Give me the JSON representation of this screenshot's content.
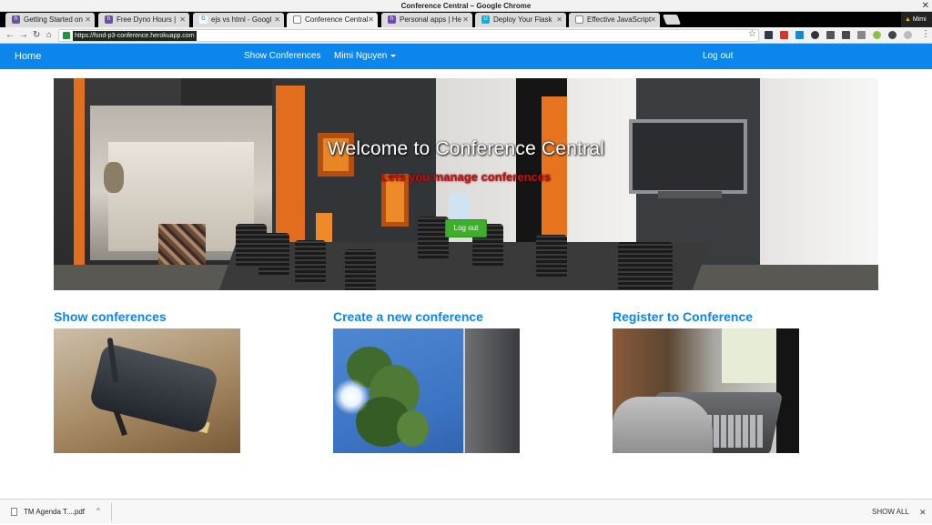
{
  "window": {
    "title": "Conference Central – Google Chrome"
  },
  "tabs": [
    {
      "label": "Getting Started on",
      "favicon": "heroku",
      "favicon_color": "#6d4eac"
    },
    {
      "label": "Free Dyno Hours |",
      "favicon": "heroku",
      "favicon_color": "#6d4eac"
    },
    {
      "label": "ejs vs html - Googl",
      "favicon": "google",
      "favicon_color": "#ffffff"
    },
    {
      "label": "Conference Central",
      "favicon": "page",
      "favicon_color": "#ffffff"
    },
    {
      "label": "Personal apps | He",
      "favicon": "heroku",
      "favicon_color": "#6d4eac"
    },
    {
      "label": "Deploy Your Flask",
      "favicon": "udacity",
      "favicon_color": "#02b3e4"
    },
    {
      "label": "Effective JavaScript",
      "favicon": "page",
      "favicon_color": "#ffffff"
    }
  ],
  "profile": {
    "warning": "▲",
    "name": "Mimi"
  },
  "addressbar": {
    "url": "https://fsnd-p3-conference.herokuapp.com"
  },
  "extension_colors": [
    "#303a44",
    "#d8362b",
    "#1f86c8",
    "#333333",
    "#555555",
    "#4a4a4a",
    "#8bc34a",
    "#bbbbbb",
    "#888888"
  ],
  "nav": {
    "brand": "Home",
    "show_conferences": "Show Conferences",
    "user": "Mimi Nguyen",
    "logout": "Log out"
  },
  "hero": {
    "title": "Welcome to Conference Central",
    "subtitle": "Lets you manage conferences",
    "button": "Log out"
  },
  "cards": [
    {
      "title": "Show conferences"
    },
    {
      "title": "Create a new conference"
    },
    {
      "title": "Register to Conference"
    }
  ],
  "colors": {
    "accent": "#0d86ec",
    "hero_subtitle": "#c01010",
    "hero_button": "#3fae2b"
  },
  "downloads": {
    "file": "TM Agenda T....pdf",
    "show_all": "SHOW ALL"
  }
}
